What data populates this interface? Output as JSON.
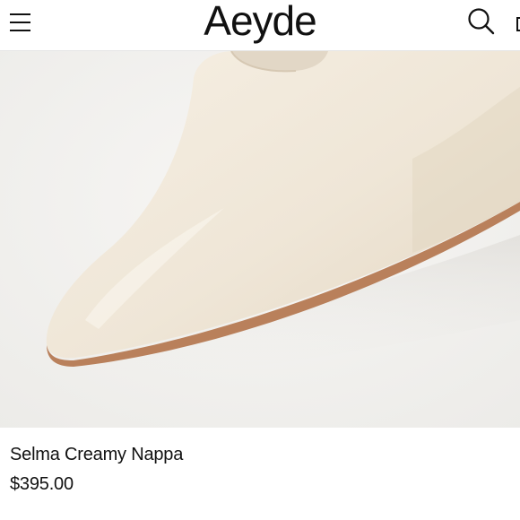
{
  "header": {
    "brand": "Aeyde",
    "menu_icon": "hamburger-menu-icon",
    "search_icon": "search-icon",
    "cart_icon": "shopping-bag-icon"
  },
  "product": {
    "image_alt_subject": "pointed-toe cream leather flat",
    "name": "Selma Creamy Nappa",
    "price": "$395.00"
  },
  "colors": {
    "text": "#111111",
    "image_background": "#f3f2f0",
    "shoe_leather": "#efe6d8",
    "shoe_sole": "#b87d58"
  }
}
